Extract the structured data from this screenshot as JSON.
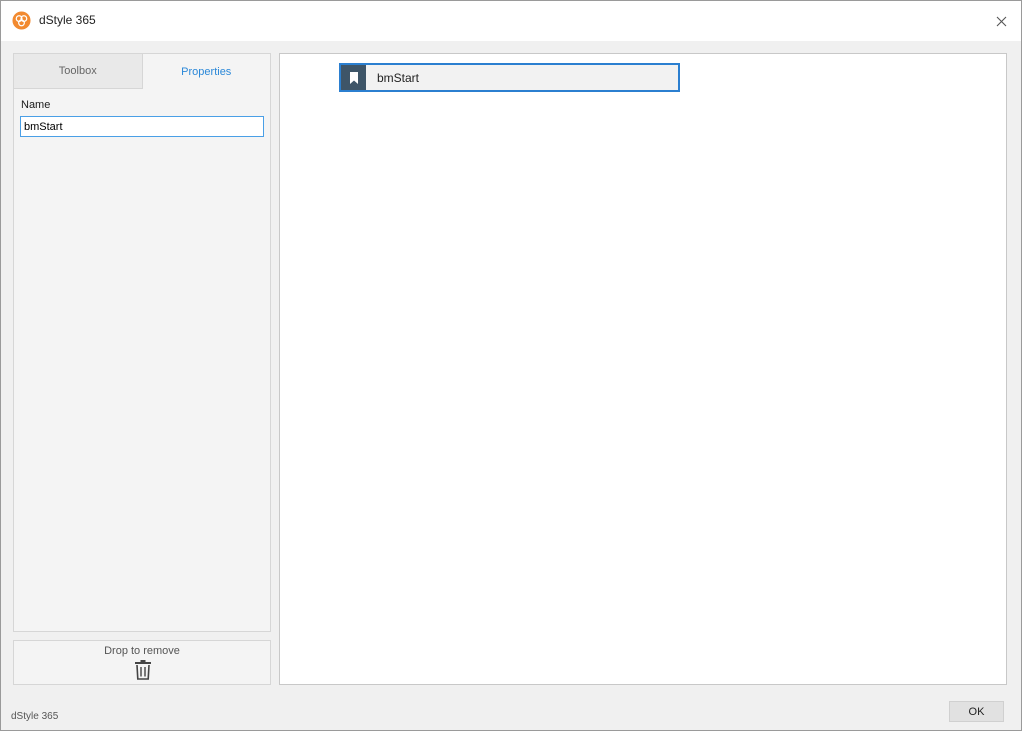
{
  "window": {
    "title": "dStyle 365",
    "app_icon": "dstyle-logo-icon",
    "close_icon": "close-icon"
  },
  "left_panel": {
    "tabs": [
      {
        "label": "Toolbox",
        "active": false
      },
      {
        "label": "Properties",
        "active": true
      }
    ],
    "properties": {
      "name_label": "Name",
      "name_value": "bmStart"
    }
  },
  "drop_zone": {
    "label": "Drop to remove",
    "icon": "trash-icon"
  },
  "canvas": {
    "items": [
      {
        "label": "bmStart",
        "icon": "bookmark-icon",
        "selected": true
      }
    ]
  },
  "footer": {
    "status_text": "dStyle 365",
    "ok_label": "OK"
  },
  "colors": {
    "accent": "#2b7fd0",
    "active_tab_text": "#2b88d8",
    "bookmark_badge": "#3e5568",
    "app_icon": "#f28a30"
  }
}
